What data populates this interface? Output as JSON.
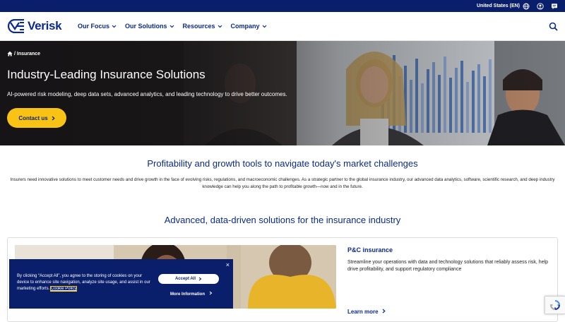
{
  "utility": {
    "region": "United States (EN)"
  },
  "brand": {
    "name": "Verisk"
  },
  "nav": {
    "items": [
      "Our Focus",
      "Our Solutions",
      "Resources",
      "Company"
    ],
    "chevron": "⌄"
  },
  "hero": {
    "breadcrumb": "/ Insurance",
    "title": "Industry-Leading Insurance Solutions",
    "subtitle": "AI-powered risk modeling, deep data sets, advanced analytics, and leading technology to drive better outcomes.",
    "cta": "Contact us"
  },
  "section1": {
    "title": "Profitability and growth tools to navigate today's market challenges",
    "body": "Insurers need innovative solutions to meet customer needs and drive growth in the face of evolving risks, regulations, and macroeconomic challenges. As a strategic partner to the global insurance industry, our advanced data analytics, software, scientific research, and deep industry knowledge can help you along the path to profitable growth—now and in the future."
  },
  "section2": {
    "title": "Advanced, data-driven solutions for the insurance industry"
  },
  "card": {
    "title": "P&C insurance",
    "description": "Streamline your operations with data and technology solutions that reliably assess risk, help drive profitability, and support regulatory compliance",
    "link": "Learn more"
  },
  "cookie": {
    "text": "By clicking “Accept All”, you agree to the storing of cookies on your device to enhance site navigation, analyze site usage, and assist in our marketing efforts.",
    "link": "Cookie Policy",
    "accept": "Accept All",
    "more": "More Information",
    "close": "×"
  },
  "colors": {
    "brand_navy": "#0a1f6b",
    "brand_blue": "#0a2a8c",
    "accent_yellow": "#f9c315"
  },
  "icons": [
    "globe-icon",
    "user-icon",
    "chat-icon",
    "search-icon",
    "home-icon",
    "chevron-right-icon",
    "close-icon",
    "recaptcha-icon"
  ]
}
